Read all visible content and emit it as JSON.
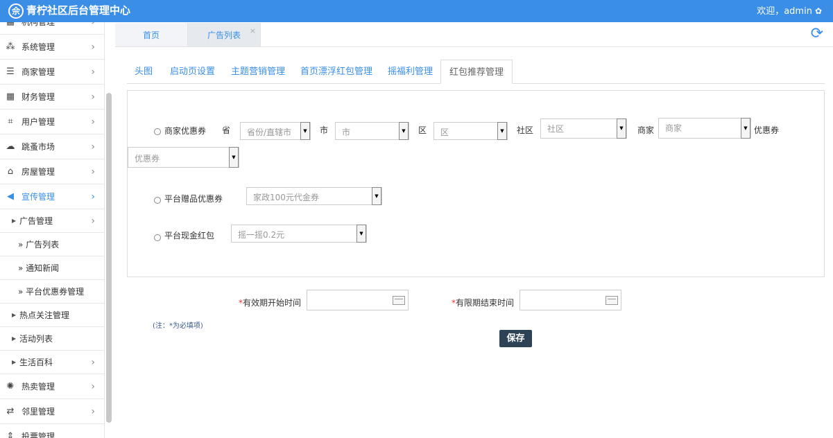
{
  "header": {
    "logo_glyph": "佘",
    "title": "青柠社区后台管理中心",
    "welcome": "欢迎，admin"
  },
  "sidebar": {
    "items": [
      {
        "label": "机构管理",
        "icon": "building-icon"
      },
      {
        "label": "系统管理",
        "icon": "network-icon"
      },
      {
        "label": "商家管理",
        "icon": "list-icon"
      },
      {
        "label": "财务管理",
        "icon": "table-icon"
      },
      {
        "label": "用户管理",
        "icon": "crop-icon"
      },
      {
        "label": "跳蚤市场",
        "icon": "cloud-icon"
      },
      {
        "label": "房屋管理",
        "icon": "bank-icon"
      },
      {
        "label": "宣传管理",
        "icon": "megaphone-icon"
      }
    ],
    "sub_ad": "广告管理",
    "leaves": [
      "» 广告列表",
      "» 通知新闻",
      "» 平台优惠券管理"
    ],
    "sub_more": [
      "热点关注管理",
      "活动列表",
      "生活百科"
    ],
    "bottom_items": [
      {
        "label": "热卖管理",
        "icon": "sun-icon"
      },
      {
        "label": "邻里管理",
        "icon": "retweet-icon"
      },
      {
        "label": "投票管理",
        "icon": "sort-icon"
      }
    ]
  },
  "tabs": [
    {
      "label": "首页"
    },
    {
      "label": "广告列表"
    }
  ],
  "subtabs": [
    "头图",
    "启动页设置",
    "主题营销管理",
    "首页漂浮红包管理",
    "摇福利管理",
    "红包推荐管理"
  ],
  "form": {
    "merchant_coupon_label": "商家优惠券",
    "province_label": "省",
    "province_placeholder": "省份/直辖市",
    "city_label": "市",
    "city_placeholder": "市",
    "district_label": "区",
    "district_placeholder": "区",
    "community_label": "社区",
    "community_placeholder": "社区",
    "merchant_label": "商家",
    "merchant_placeholder": "商家",
    "coupon_label": "优惠券",
    "coupon_placeholder": "优惠券",
    "platform_gift_label": "平台赠品优惠券",
    "platform_gift_value": "家政100元代金券",
    "platform_cash_label": "平台现金红包",
    "platform_cash_value": "摇一摇0.2元",
    "start_label": "有效期开始时间",
    "end_label": "有限期结束时间",
    "required_mark": "*",
    "note": "(注：*为必填项)",
    "save": "保存"
  }
}
